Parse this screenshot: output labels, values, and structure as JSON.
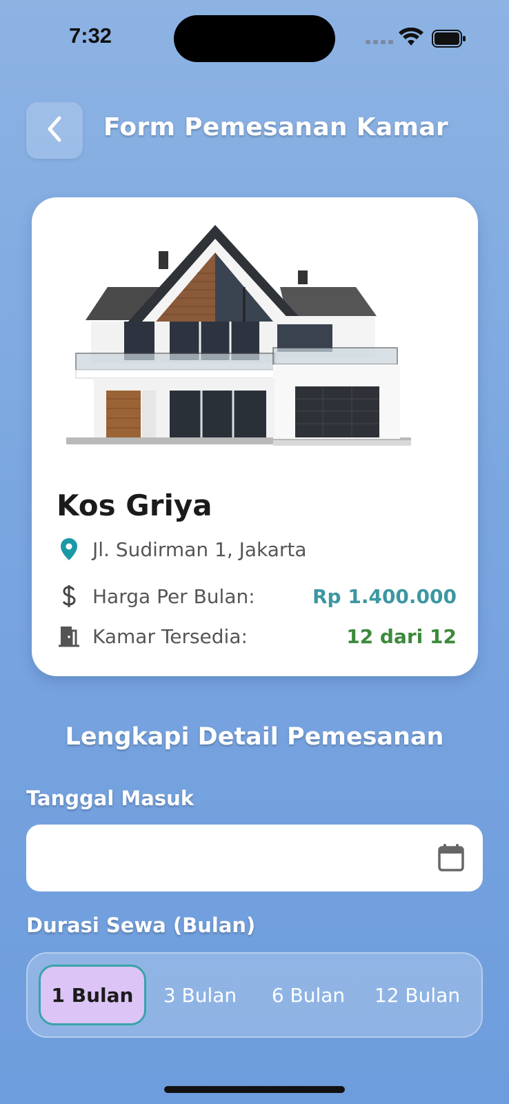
{
  "status_bar": {
    "time": "7:32"
  },
  "header": {
    "title": "Form Pemesanan Kamar"
  },
  "kos": {
    "name": "Kos Griya",
    "address": "Jl. Sudirman 1, Jakarta",
    "price_label": "Harga Per Bulan:",
    "price_value": "Rp 1.400.000",
    "rooms_label": "Kamar Tersedia:",
    "rooms_value": "12 dari 12"
  },
  "form": {
    "section_title": "Lengkapi Detail Pemesanan",
    "date_label": "Tanggal Masuk",
    "date_value": "",
    "duration_label": "Durasi Sewa (Bulan)",
    "durations": [
      "1 Bulan",
      "3 Bulan",
      "6 Bulan",
      "12 Bulan"
    ],
    "selected_duration": "1 Bulan"
  },
  "colors": {
    "price": "#3c97a2",
    "rooms": "#3c8a3c",
    "selected_chip": "#dcc4f7",
    "selected_border": "#3aa3a8"
  },
  "icons": [
    "chevron-left-icon",
    "location-pin-icon",
    "dollar-icon",
    "door-icon",
    "calendar-icon",
    "wifi-icon",
    "battery-icon"
  ]
}
